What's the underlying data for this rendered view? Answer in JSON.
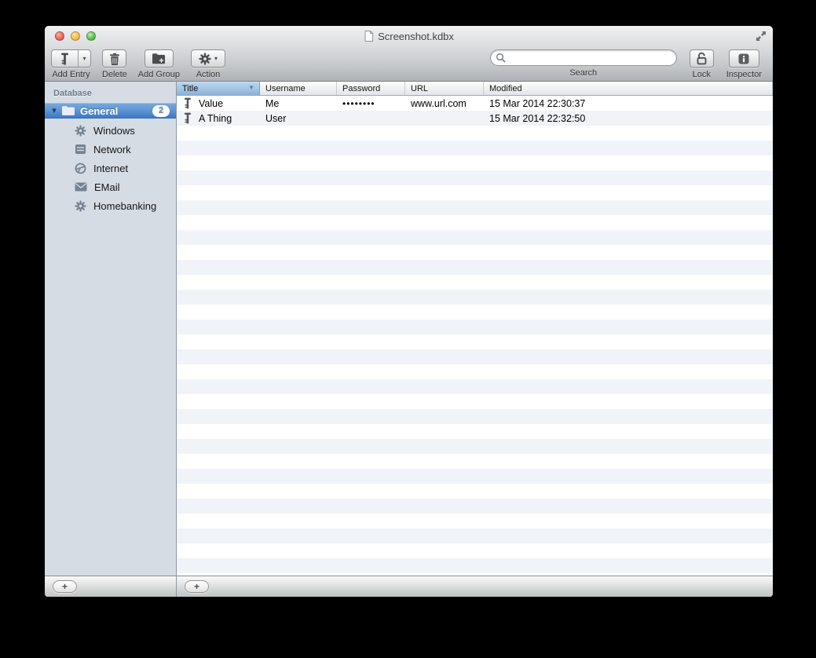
{
  "window": {
    "title": "Screenshot.kdbx"
  },
  "toolbar": {
    "add_entry": {
      "label": "Add Entry",
      "icon": "key-icon"
    },
    "delete": {
      "label": "Delete",
      "icon": "trash-icon"
    },
    "add_group": {
      "label": "Add Group",
      "icon": "folder-plus-icon"
    },
    "action": {
      "label": "Action",
      "icon": "gear-icon"
    },
    "search": {
      "label": "Search",
      "value": "",
      "icon": "search-icon"
    },
    "lock": {
      "label": "Lock",
      "icon": "lock-open-icon"
    },
    "inspector": {
      "label": "Inspector",
      "icon": "info-icon"
    }
  },
  "sidebar": {
    "section_label": "Database",
    "group": {
      "label": "General",
      "badge": "2",
      "icon": "folder-icon",
      "expanded": true,
      "selected": true
    },
    "items": [
      {
        "label": "Windows",
        "icon": "gear-icon"
      },
      {
        "label": "Network",
        "icon": "network-icon"
      },
      {
        "label": "Internet",
        "icon": "globe-icon"
      },
      {
        "label": "EMail",
        "icon": "mail-icon"
      },
      {
        "label": "Homebanking",
        "icon": "gear-icon"
      }
    ],
    "add_button_label": "+"
  },
  "table": {
    "columns": [
      {
        "label": "Title",
        "sort": "desc"
      },
      {
        "label": "Username",
        "sort": null
      },
      {
        "label": "Password",
        "sort": null
      },
      {
        "label": "URL",
        "sort": null
      },
      {
        "label": "Modified",
        "sort": null
      }
    ],
    "rows": [
      {
        "icon": "key-icon",
        "title": "Value",
        "username": "Me",
        "password": "••••••••",
        "url": "www.url.com",
        "modified": "15 Mar 2014 22:30:37"
      },
      {
        "icon": "key-icon",
        "title": "A Thing",
        "username": "User",
        "password": "",
        "url": "",
        "modified": "15 Mar 2014 22:32:50"
      }
    ],
    "add_button_label": "+"
  },
  "colors": {
    "selection_blue": "#3a73c0",
    "sidebar_bg": "#d5dce4",
    "row_stripe": "#f0f4f9",
    "sorted_header_blue": "#8ab0d8"
  }
}
